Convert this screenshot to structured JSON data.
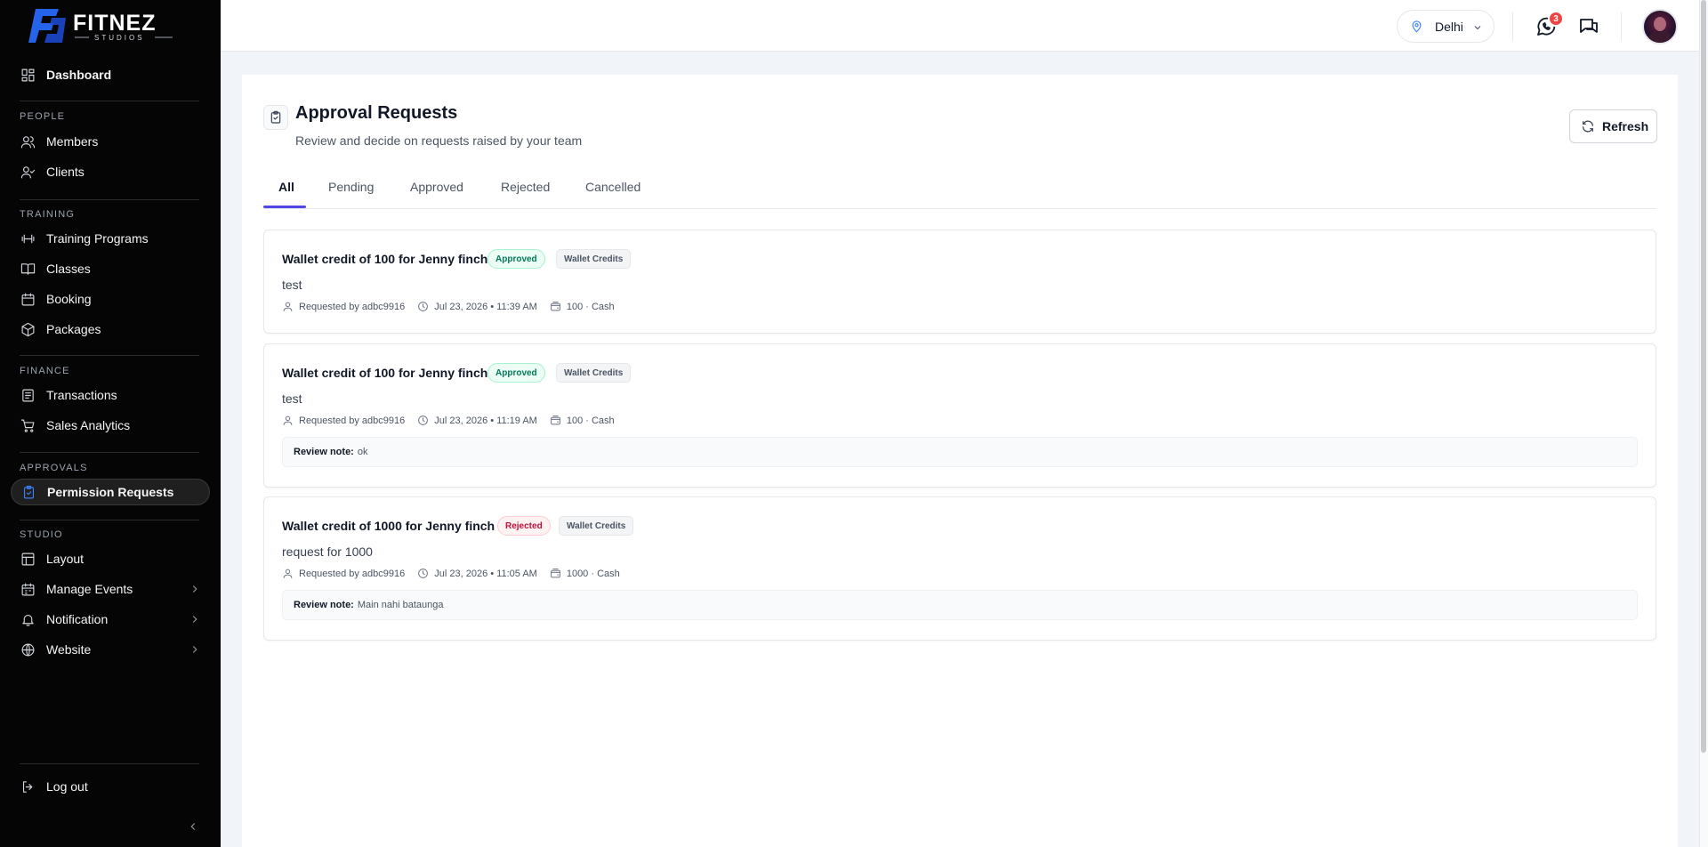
{
  "brand": {
    "name": "FITNEZ",
    "tagline": "STUDIOS"
  },
  "sidebar": {
    "dashboard": "Dashboard",
    "sections": {
      "people": "PEOPLE",
      "training": "TRAINING",
      "finance": "FINANCE",
      "approvals": "APPROVALS",
      "studio": "STUDIO"
    },
    "items": {
      "members": "Members",
      "clients": "Clients",
      "training_programs": "Training Programs",
      "classes": "Classes",
      "booking": "Booking",
      "packages": "Packages",
      "transactions": "Transactions",
      "sales_analytics": "Sales Analytics",
      "permission_requests": "Permission Requests",
      "layout": "Layout",
      "manage_events": "Manage Events",
      "notification": "Notification",
      "website": "Website"
    },
    "logout": "Log out"
  },
  "topbar": {
    "location": "Delhi",
    "whatsapp_count": "3"
  },
  "page": {
    "title": "Approval Requests",
    "subtitle": "Review and decide on requests raised by your team",
    "refresh_label": "Refresh",
    "tabs": [
      "All",
      "Pending",
      "Approved",
      "Rejected",
      "Cancelled"
    ],
    "active_tab": "All"
  },
  "requests": [
    {
      "title": "Wallet credit of 100 for Jenny finch",
      "status": "Approved",
      "category": "Wallet Credits",
      "description": "test",
      "requested_by": "Requested by adbc9916",
      "time": "Jul 23, 2026 • 11:39 AM",
      "amount": "100 · Cash"
    },
    {
      "title": "Wallet credit of 100 for Jenny finch",
      "status": "Approved",
      "category": "Wallet Credits",
      "description": "test",
      "requested_by": "Requested by adbc9916",
      "time": "Jul 23, 2026 • 11:19 AM",
      "amount": "100 · Cash",
      "review_label": "Review note:",
      "review_note": "ok"
    },
    {
      "title": "Wallet credit of 1000 for Jenny finch",
      "status": "Rejected",
      "category": "Wallet Credits",
      "description": "request for 1000",
      "requested_by": "Requested by adbc9916",
      "time": "Jul 23, 2026 • 11:05 AM",
      "amount": "1000 · Cash",
      "review_label": "Review note:",
      "review_note": "Main nahi bataunga"
    }
  ],
  "colors": {
    "sidebar_bg": "#050505",
    "accent": "#4f46e5",
    "approved": "#047857",
    "rejected": "#be123c",
    "brand_blue": "#2563eb"
  }
}
